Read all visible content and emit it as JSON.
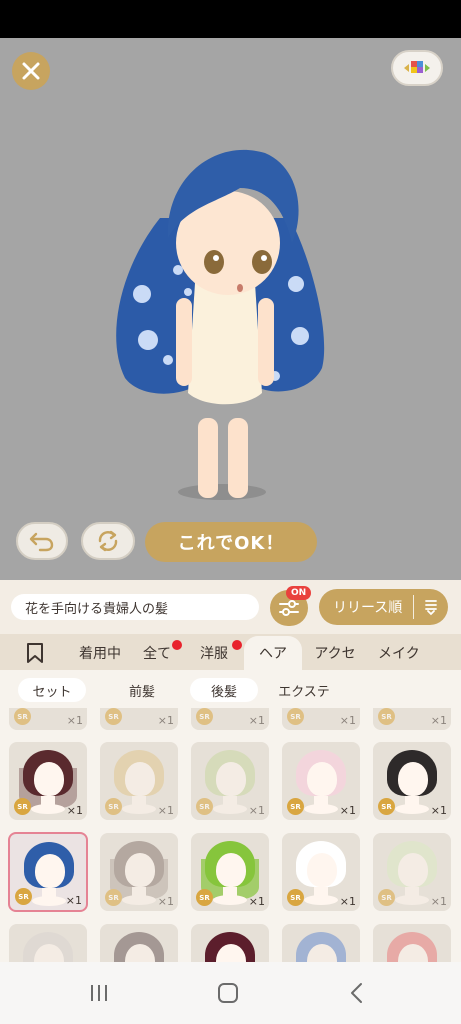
{
  "header": {
    "close_icon": "close-icon",
    "switch_icon": "palette-switch-icon"
  },
  "preview": {
    "ok_label": "これでOK！",
    "undo_icon": "undo-icon",
    "rotate_icon": "rotate-icon"
  },
  "info": {
    "item_name": "花を手向ける貴婦人の髪",
    "filter_badge": "ON",
    "sort_label": "リリース順"
  },
  "tabs": [
    {
      "label": ""
    },
    {
      "label": "着用中"
    },
    {
      "label": "全て"
    },
    {
      "label": "洋服"
    },
    {
      "label": "ヘア"
    },
    {
      "label": "アクセ"
    },
    {
      "label": "メイク"
    }
  ],
  "subtabs": [
    {
      "label": "セット"
    },
    {
      "label": "前髪"
    },
    {
      "label": "後髪"
    },
    {
      "label": "エクステ"
    }
  ],
  "items": [
    {
      "rarity": "SR",
      "qty": "×1",
      "hair_color": "#5a2a2e"
    },
    {
      "rarity": "SR",
      "qty": "×1",
      "hair_color": "#e0c790"
    },
    {
      "rarity": "SR",
      "qty": "×1",
      "hair_color": "#c9d7a3"
    },
    {
      "rarity": "SR",
      "qty": "×1",
      "hair_color": "#f3d5dc"
    },
    {
      "rarity": "SR",
      "qty": "×1",
      "hair_color": "#2e2a2a"
    },
    {
      "rarity": "SR",
      "qty": "×1",
      "hair_color": "#2f5ea9"
    },
    {
      "rarity": "SR",
      "qty": "×1",
      "hair_color": "#8a7a74"
    },
    {
      "rarity": "SR",
      "qty": "×1",
      "hair_color": "#86c53c"
    },
    {
      "rarity": "SR",
      "qty": "×1",
      "hair_color": "#ffffff"
    },
    {
      "rarity": "SR",
      "qty": "×1",
      "hair_color": "#dbeac4"
    }
  ],
  "top_partial_row": [
    {
      "rarity": "SR",
      "qty": "×1"
    },
    {
      "rarity": "SR",
      "qty": "×1"
    },
    {
      "rarity": "SR",
      "qty": "×1"
    },
    {
      "rarity": "SR",
      "qty": "×1"
    },
    {
      "rarity": "SR",
      "qty": "×1"
    }
  ],
  "bottom_partial_row_colors": [
    "#d9d4d0",
    "#6e5e5e",
    "#5c1e2c",
    "#6b8fcf",
    "#e87f7f"
  ],
  "colors": {
    "gold": "#c7a45f",
    "stage_bg": "#a5a5a5",
    "panel_bg": "#f3ede4",
    "selected_border": "#e58394",
    "alert_red": "#e8232d"
  }
}
